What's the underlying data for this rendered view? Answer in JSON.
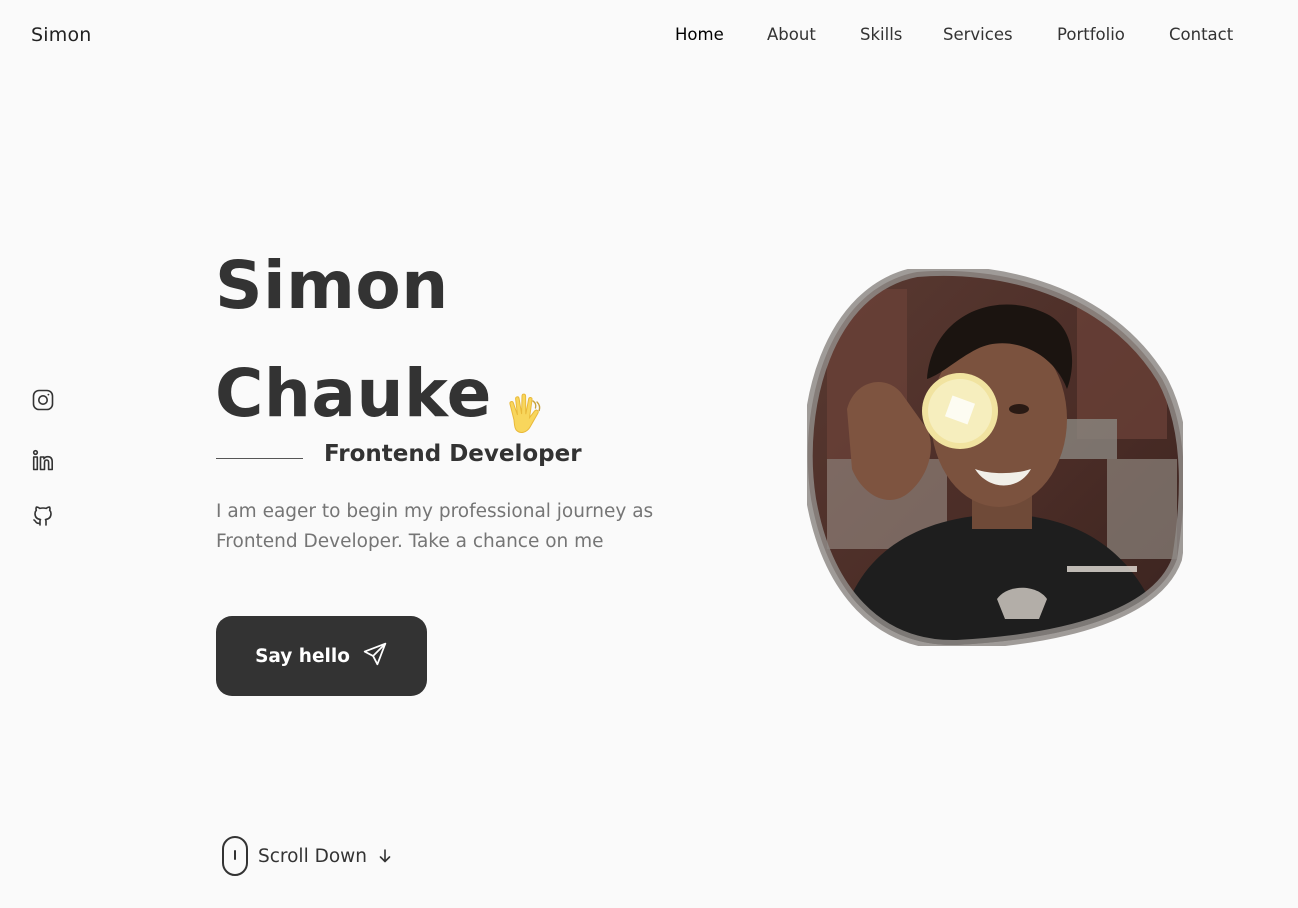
{
  "header": {
    "logo": "Simon",
    "nav": [
      {
        "label": "Home",
        "active": true
      },
      {
        "label": "About",
        "active": false
      },
      {
        "label": "Skills",
        "active": false
      },
      {
        "label": "Services",
        "active": false
      },
      {
        "label": "Portfolio",
        "active": false
      },
      {
        "label": "Contact",
        "active": false
      }
    ]
  },
  "social": [
    {
      "icon": "instagram-icon"
    },
    {
      "icon": "linkedin-icon"
    },
    {
      "icon": "github-icon"
    }
  ],
  "hero": {
    "first_name": "Simon",
    "last_name": "Chauke",
    "wave_icon": "waving-hand-icon",
    "subtitle": "Frontend Developer",
    "description": "I am eager to begin my professional journey as Frontend Developer. Take a chance on me",
    "cta_label": "Say hello",
    "cta_icon": "send-icon",
    "image_icon": "profile-photo"
  },
  "scroll": {
    "label": "Scroll Down",
    "mouse_icon": "mouse-icon",
    "arrow_icon": "arrow-down-icon"
  },
  "colors": {
    "background": "#fafafa",
    "text": "#333333",
    "muted": "#757575",
    "button": "#333333",
    "wave": "#f8d65c"
  }
}
